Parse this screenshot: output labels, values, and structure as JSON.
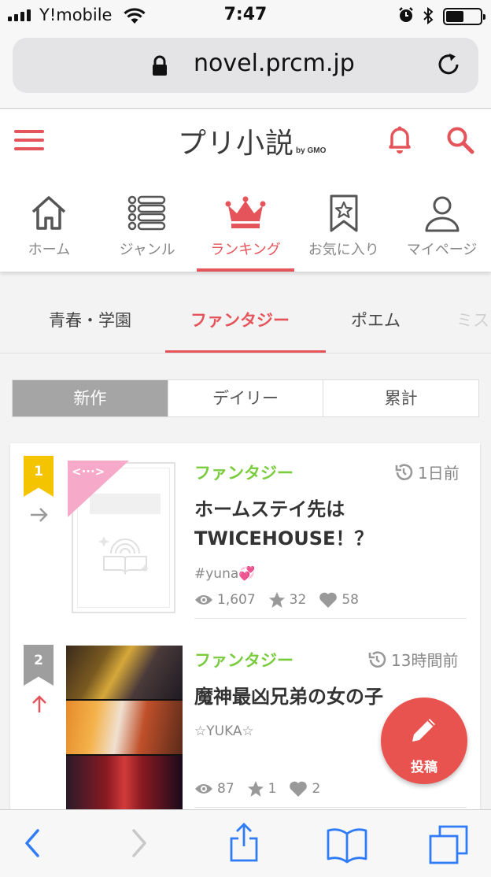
{
  "status_bar": {
    "carrier": "Y!mobile",
    "time": "7:47"
  },
  "browser": {
    "url": "novel.prcm.jp"
  },
  "site": {
    "logo": "プリ小説",
    "logo_sub": "by GMO"
  },
  "main_nav": [
    {
      "label": "ホーム"
    },
    {
      "label": "ジャンル"
    },
    {
      "label": "ランキング",
      "active": true
    },
    {
      "label": "お気に入り"
    },
    {
      "label": "マイページ"
    }
  ],
  "genre_tabs": [
    "青春・学園",
    "ファンタジー",
    "ポエム",
    "ミス"
  ],
  "ranking_tabs": [
    "新作",
    "デイリー",
    "累計"
  ],
  "stories": [
    {
      "rank": "1",
      "rank_color": "#f5c400",
      "trend": "same",
      "genre": "ファンタジー",
      "updated": "1日前",
      "title": "ホームステイ先はTWICEHOUSE！？",
      "tag": "#yuna💞",
      "views": "1,607",
      "stars": "32",
      "likes": "58"
    },
    {
      "rank": "2",
      "rank_color": "#9e9e9e",
      "trend": "up",
      "genre": "ファンタジー",
      "updated": "13時間前",
      "title": "魔神最凶兄弟の女の子",
      "tag": "☆YUKA☆",
      "views": "87",
      "stars": "1",
      "likes": "2"
    }
  ],
  "fab": {
    "label": "投稿"
  },
  "colors": {
    "accent": "#e5545a",
    "genre_green": "#7acc3e",
    "gold": "#f5c400"
  }
}
